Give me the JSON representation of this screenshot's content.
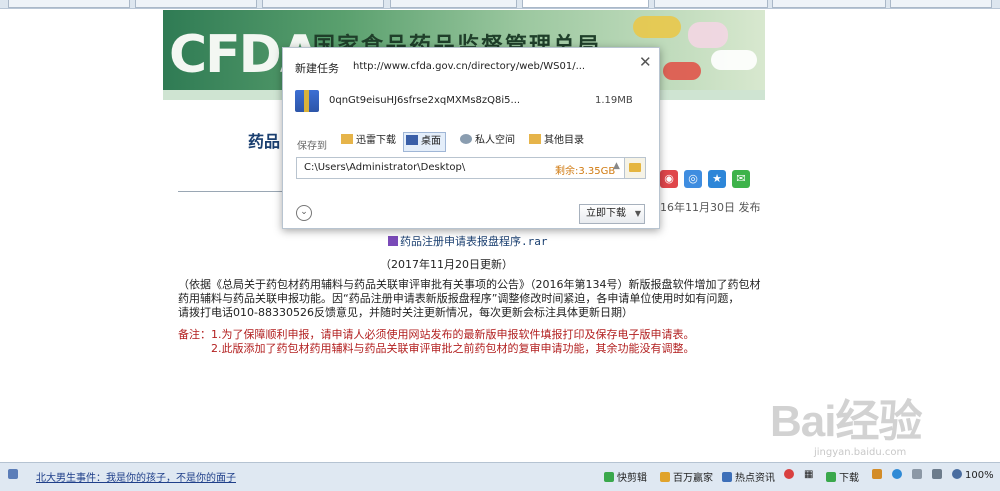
{
  "banner": {
    "logo_text": "CFDA",
    "title": "国家食品药品监督管理总局"
  },
  "article": {
    "heading_start": "药品",
    "heading_end": ")",
    "pubdate": "16年11月30日 发布",
    "file_link": "药品注册申请表报盘程序.rar",
    "update_note": "（2017年11月20日更新）",
    "paragraph": [
      "（依据《总局关于药包材药用辅料与药品关联审评审批有关事项的公告》（2016年第134号）新版报盘软件增加了药包材",
      "药用辅料与药品关联申报功能。因“药品注册申请表新版报盘程序”调整修改时间紧迫，各申请单位使用时如有问题，",
      "请拨打电话010-88330526反馈意见，并随时关注更新情况，每次更新会标注具体更新日期）"
    ],
    "remark": [
      "备注：1.为了保障顺利申报，请申请人必须使用网站发布的最新版申报软件填报打印及保存电子版申请表。",
      "　　　2.此版添加了药包材药用辅料与药品关联审评审批之前药包材的复审申请功能，其余功能没有调整。"
    ]
  },
  "dialog": {
    "title": "新建任务",
    "url": "http://www.cfda.gov.cn/directory/web/WS01/...",
    "file_name": "0qnGt9eisuHJ6sfrse2xqMXMs8zQ8i5...",
    "file_size": "1.19MB",
    "save_to_label": "保存到",
    "locations": [
      "迅雷下载",
      "桌面",
      "私人空间",
      "其他目录"
    ],
    "selected_location": "桌面",
    "path": "C:\\Users\\Administrator\\Desktop\\",
    "free_space": "剩余:3.35GB",
    "download_button": "立即下载"
  },
  "watermark": {
    "logo": "Bai经验",
    "url": "jingyan.baidu.com"
  },
  "statusbar": {
    "news": "北大男生事件：我是你的孩子，不是你的面子",
    "items": [
      "快剪辑",
      "百万赢家",
      "热点资讯",
      "下载",
      "100%"
    ]
  },
  "colors": {
    "link_blue": "#1a3f70",
    "remark_red": "#b21f1f",
    "free_space_orange": "#d07a10"
  }
}
